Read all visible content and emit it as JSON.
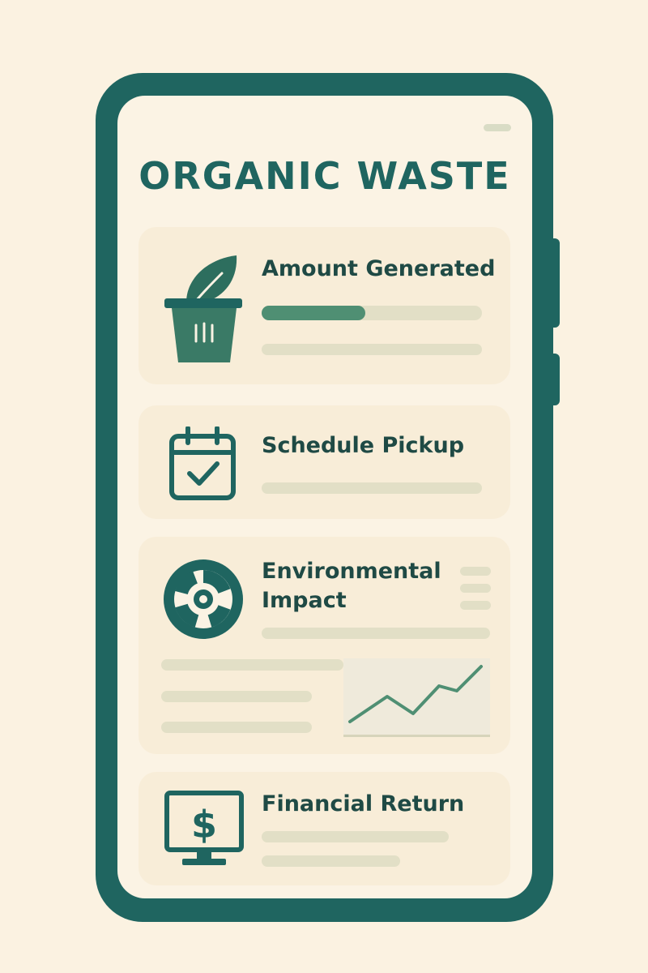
{
  "app": {
    "title": "ORGANIC WASTE"
  },
  "cards": [
    {
      "label": "Amount Generated",
      "icon": "compost-bin-icon",
      "progress_fraction": 0.47
    },
    {
      "label": "Schedule Pickup",
      "icon": "calendar-check-icon"
    },
    {
      "label": "Environmental Impact",
      "icon": "recycle-cycle-icon",
      "trend_chart": true
    },
    {
      "label": "Financial Return",
      "icon": "dollar-monitor-icon"
    }
  ],
  "colors": {
    "primary": "#1f6560",
    "accent": "#4f8f73",
    "background": "#fbf2e1",
    "card": "#f8edd8",
    "placeholder": "#e2dfc6"
  }
}
